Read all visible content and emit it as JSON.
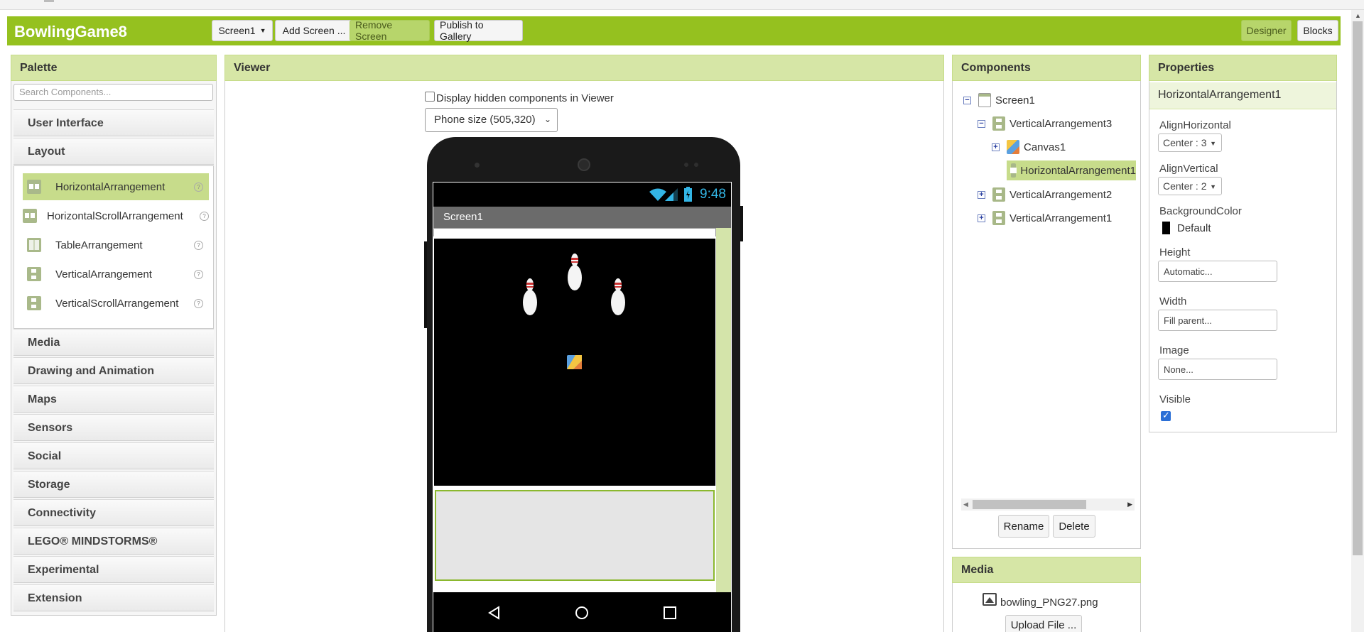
{
  "toolbar": {
    "app_title": "BowlingGame8",
    "screen_dropdown": "Screen1",
    "add_screen": "Add Screen ...",
    "remove_screen": "Remove Screen",
    "publish": "Publish to Gallery",
    "designer": "Designer",
    "blocks": "Blocks"
  },
  "palette": {
    "title": "Palette",
    "search_placeholder": "Search Components...",
    "categories": [
      "User Interface",
      "Layout",
      "Media",
      "Drawing and Animation",
      "Maps",
      "Sensors",
      "Social",
      "Storage",
      "Connectivity",
      "LEGO® MINDSTORMS®",
      "Experimental",
      "Extension"
    ],
    "layout_items": [
      {
        "label": "HorizontalArrangement",
        "icon": "horizontal-arrangement-icon",
        "selected": true
      },
      {
        "label": "HorizontalScrollArrangement",
        "icon": "horizontal-scroll-arrangement-icon"
      },
      {
        "label": "TableArrangement",
        "icon": "table-arrangement-icon"
      },
      {
        "label": "VerticalArrangement",
        "icon": "vertical-arrangement-icon"
      },
      {
        "label": "VerticalScrollArrangement",
        "icon": "vertical-scroll-arrangement-icon"
      }
    ],
    "help_glyph": "?"
  },
  "viewer": {
    "title": "Viewer",
    "hidden_checkbox_label": "Display hidden components in Viewer",
    "phone_size": "Phone size (505,320)",
    "phone": {
      "status_time": "9:48",
      "screen_title": "Screen1"
    }
  },
  "components": {
    "title": "Components",
    "tree": [
      {
        "label": "Screen1",
        "toggle": "−"
      },
      {
        "label": "VerticalArrangement3",
        "toggle": "−"
      },
      {
        "label": "Canvas1",
        "toggle": "+"
      },
      {
        "label": "HorizontalArrangement1",
        "selected": true
      },
      {
        "label": "VerticalArrangement2",
        "toggle": "+"
      },
      {
        "label": "VerticalArrangement1",
        "toggle": "+"
      }
    ],
    "rename": "Rename",
    "delete": "Delete"
  },
  "media": {
    "title": "Media",
    "file": "bowling_PNG27.png",
    "upload": "Upload File ..."
  },
  "properties": {
    "title": "Properties",
    "component": "HorizontalArrangement1",
    "align_horizontal_label": "AlignHorizontal",
    "align_horizontal_value": "Center : 3",
    "align_vertical_label": "AlignVertical",
    "align_vertical_value": "Center : 2",
    "background_color_label": "BackgroundColor",
    "background_color_value": "Default",
    "height_label": "Height",
    "height_value": "Automatic...",
    "width_label": "Width",
    "width_value": "Fill parent...",
    "image_label": "Image",
    "image_value": "None...",
    "visible_label": "Visible",
    "visible_checked": true
  },
  "colors": {
    "toolbar_green": "#95c11f",
    "panel_header": "#d6e6a6",
    "selection": "#c7dc8b",
    "status_text": "#33b5e5"
  }
}
